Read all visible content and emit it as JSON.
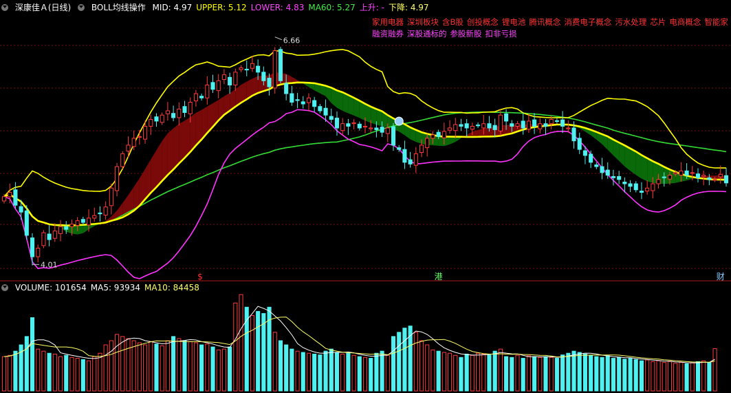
{
  "main_panel": {
    "stock_name": "深康佳Ａ",
    "period": "(日线)",
    "indicator_name": "BOLL均线操作",
    "readouts": [
      {
        "key": "mid",
        "label": "MID: 4.97",
        "color": "#ffffff"
      },
      {
        "key": "upper",
        "label": "UPPER: 5.12",
        "color": "#ffff00"
      },
      {
        "key": "lower",
        "label": "LOWER: 4.83",
        "color": "#ff44ff"
      },
      {
        "key": "ma60",
        "label": "MA60: 5.27",
        "color": "#44ee44"
      },
      {
        "key": "up",
        "label": "上升: -",
        "color": "#ff44ff"
      },
      {
        "key": "down",
        "label": "下降: 4.97",
        "color": "#ffff66"
      }
    ],
    "concept_tags_row1": [
      "家用电器",
      "深圳板块",
      "含B股",
      "创投概念",
      "锂电池",
      "腾讯概念",
      "消费电子概念",
      "污水处理",
      "芯片",
      "电商概念",
      "智能家"
    ],
    "concept_tags_row2": [
      "融资融券",
      "深股通标的",
      "参股新股",
      "扣非亏损"
    ],
    "tag_color_row1": "#ff3333",
    "tag_color_row2": "#ff44ff",
    "high_label": "6.66",
    "low_label": "4.01",
    "event_markers": [
      {
        "text": "$",
        "color": "#ff3333"
      },
      {
        "text": "港",
        "color": "#66ff66"
      },
      {
        "text": "财",
        "color": "#88ccff"
      }
    ]
  },
  "volume_panel": {
    "readouts": [
      {
        "key": "volume",
        "label": "VOLUME: 101654",
        "color": "#ffffff"
      },
      {
        "key": "ma5",
        "label": "MA5: 93934",
        "color": "#ffffff"
      },
      {
        "key": "ma10",
        "label": "MA10: 84458",
        "color": "#ffff66"
      }
    ]
  },
  "colors": {
    "up": "#ff3b3b",
    "down": "#4ef0f0",
    "upper_band": "#ffff00",
    "lower_band": "#ff33ff",
    "ma60": "#33dd33",
    "mid_up_fill": "#7a0a0a",
    "mid_down_fill": "#0a6a0a",
    "grid": "#7a1010",
    "divider": "#b01818"
  },
  "chart_data": {
    "type": "candlestick",
    "price_range": [
      3.9,
      6.85
    ],
    "closes": [
      4.8,
      4.85,
      4.7,
      4.62,
      4.35,
      4.1,
      4.2,
      4.38,
      4.3,
      4.4,
      4.45,
      4.42,
      4.48,
      4.52,
      4.5,
      4.55,
      4.58,
      4.6,
      4.68,
      4.9,
      5.15,
      5.3,
      5.4,
      5.48,
      5.5,
      5.62,
      5.7,
      5.68,
      5.75,
      5.8,
      5.72,
      5.82,
      5.78,
      5.9,
      6.0,
      5.95,
      6.1,
      6.05,
      6.15,
      6.22,
      6.1,
      6.25,
      6.3,
      6.28,
      6.35,
      6.25,
      6.15,
      6.08,
      6.5,
      6.15,
      6.0,
      5.9,
      5.92,
      5.88,
      5.95,
      5.85,
      5.8,
      5.75,
      5.7,
      5.6,
      5.65,
      5.62,
      5.66,
      5.6,
      5.62,
      5.6,
      5.58,
      5.55,
      5.6,
      5.4,
      5.35,
      5.2,
      5.18,
      5.3,
      5.4,
      5.48,
      5.52,
      5.5,
      5.56,
      5.6,
      5.64,
      5.62,
      5.6,
      5.62,
      5.63,
      5.65,
      5.6,
      5.58,
      5.75,
      5.68,
      5.62,
      5.65,
      5.6,
      5.68,
      5.62,
      5.65,
      5.62,
      5.7,
      5.68,
      5.62,
      5.6,
      5.45,
      5.35,
      5.28,
      5.2,
      5.15,
      5.08,
      5.05,
      5.02,
      5.0,
      4.95,
      4.92,
      4.88,
      4.85,
      4.9,
      4.95,
      5.0,
      5.02,
      5.05,
      5.08,
      5.1,
      5.05,
      5.08,
      5.02,
      5.05,
      5.0,
      5.0,
      5.06,
      4.96
    ],
    "volumes": [
      82,
      85,
      95,
      110,
      130,
      175,
      100,
      95,
      90,
      88,
      82,
      85,
      80,
      78,
      75,
      72,
      82,
      90,
      110,
      120,
      135,
      130,
      125,
      120,
      115,
      110,
      118,
      112,
      108,
      120,
      130,
      125,
      120,
      118,
      115,
      110,
      112,
      105,
      98,
      100,
      105,
      210,
      230,
      200,
      180,
      190,
      185,
      200,
      140,
      120,
      110,
      100,
      95,
      92,
      90,
      88,
      86,
      95,
      100,
      92,
      88,
      90,
      85,
      82,
      80,
      78,
      90,
      95,
      85,
      130,
      140,
      150,
      155,
      140,
      120,
      110,
      98,
      95,
      92,
      90,
      85,
      80,
      88,
      85,
      90,
      88,
      86,
      95,
      100,
      82,
      80,
      85,
      78,
      84,
      82,
      80,
      82,
      80,
      78,
      86,
      90,
      95,
      92,
      88,
      85,
      82,
      80,
      84,
      78,
      80,
      76,
      78,
      75,
      72,
      74,
      70,
      72,
      68,
      70,
      66,
      68,
      65,
      67,
      70,
      72,
      68,
      101
    ],
    "last_values": {
      "MID": 4.97,
      "UPPER": 5.12,
      "LOWER": 4.83,
      "MA60": 5.27,
      "VOLUME": 101654,
      "MA5": 93934,
      "MA10": 84458
    },
    "extremes": {
      "high": 6.66,
      "low": 4.01
    }
  }
}
